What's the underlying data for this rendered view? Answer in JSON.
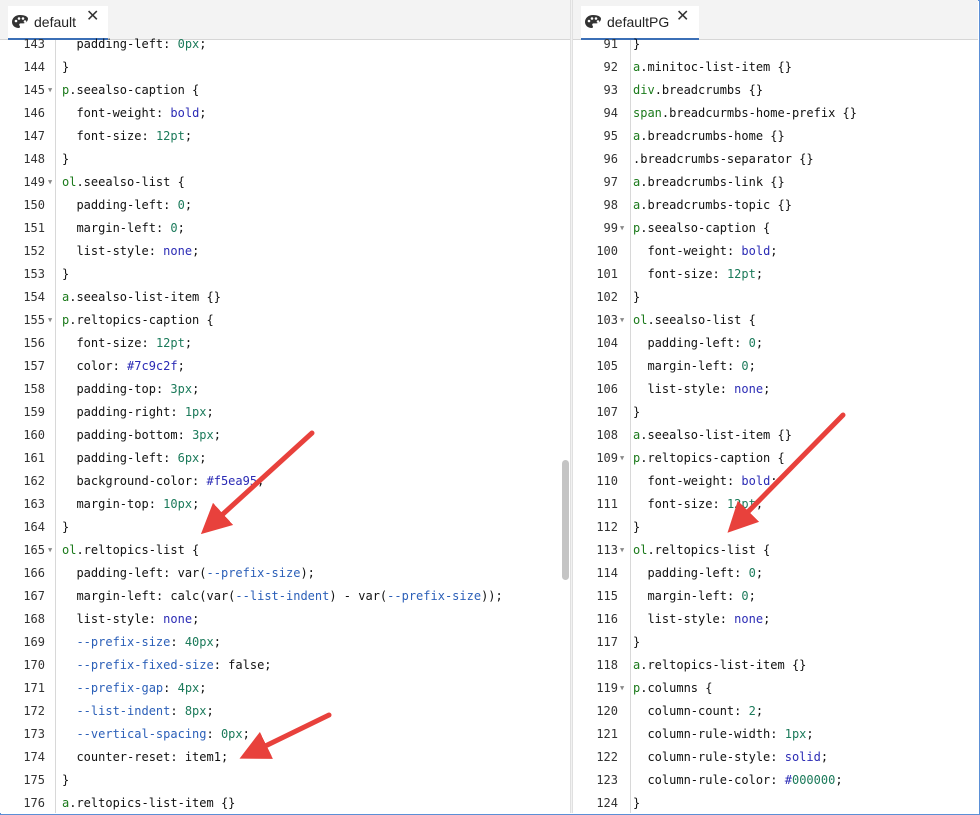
{
  "left_tab": {
    "label": "default",
    "close": "✕"
  },
  "right_tab": {
    "label": "defaultPG",
    "close": "✕"
  },
  "left_code": [
    {
      "n": "143",
      "t": "  padding-left: 0px;"
    },
    {
      "n": "144",
      "t": "}"
    },
    {
      "n": "145",
      "t": "p.seealso-caption {",
      "fold": true
    },
    {
      "n": "146",
      "t": "  font-weight: bold;"
    },
    {
      "n": "147",
      "t": "  font-size: 12pt;"
    },
    {
      "n": "148",
      "t": "}"
    },
    {
      "n": "149",
      "t": "ol.seealso-list {",
      "fold": true
    },
    {
      "n": "150",
      "t": "  padding-left: 0;"
    },
    {
      "n": "151",
      "t": "  margin-left: 0;"
    },
    {
      "n": "152",
      "t": "  list-style: none;"
    },
    {
      "n": "153",
      "t": "}"
    },
    {
      "n": "154",
      "t": "a.seealso-list-item {}"
    },
    {
      "n": "155",
      "t": "p.reltopics-caption {",
      "fold": true
    },
    {
      "n": "156",
      "t": "  font-size: 12pt;"
    },
    {
      "n": "157",
      "t": "  color: #7c9c2f;"
    },
    {
      "n": "158",
      "t": "  padding-top: 3px;"
    },
    {
      "n": "159",
      "t": "  padding-right: 1px;"
    },
    {
      "n": "160",
      "t": "  padding-bottom: 3px;"
    },
    {
      "n": "161",
      "t": "  padding-left: 6px;"
    },
    {
      "n": "162",
      "t": "  background-color: #f5ea95;"
    },
    {
      "n": "163",
      "t": "  margin-top: 10px;"
    },
    {
      "n": "164",
      "t": "}"
    },
    {
      "n": "165",
      "t": "ol.reltopics-list {",
      "fold": true
    },
    {
      "n": "166",
      "t": "  padding-left: var(--prefix-size);"
    },
    {
      "n": "167",
      "t": "  margin-left: calc(var(--list-indent) - var(--prefix-size));"
    },
    {
      "n": "168",
      "t": "  list-style: none;"
    },
    {
      "n": "169",
      "t": "  --prefix-size: 40px;"
    },
    {
      "n": "170",
      "t": "  --prefix-fixed-size: false;"
    },
    {
      "n": "171",
      "t": "  --prefix-gap: 4px;"
    },
    {
      "n": "172",
      "t": "  --list-indent: 8px;"
    },
    {
      "n": "173",
      "t": "  --vertical-spacing: 0px;"
    },
    {
      "n": "174",
      "t": "  counter-reset: item1;"
    },
    {
      "n": "175",
      "t": "}"
    },
    {
      "n": "176",
      "t": "a.reltopics-list-item {}"
    }
  ],
  "right_code": [
    {
      "n": "91",
      "t": "}"
    },
    {
      "n": "92",
      "t": "a.minitoc-list-item {}"
    },
    {
      "n": "93",
      "t": "div.breadcrumbs {}"
    },
    {
      "n": "94",
      "t": "span.breadcurmbs-home-prefix {}"
    },
    {
      "n": "95",
      "t": "a.breadcrumbs-home {}"
    },
    {
      "n": "96",
      "t": ".breadcrumbs-separator {}"
    },
    {
      "n": "97",
      "t": "a.breadcrumbs-link {}"
    },
    {
      "n": "98",
      "t": "a.breadcrumbs-topic {}"
    },
    {
      "n": "99",
      "t": "p.seealso-caption {",
      "fold": true
    },
    {
      "n": "100",
      "t": "  font-weight: bold;"
    },
    {
      "n": "101",
      "t": "  font-size: 12pt;"
    },
    {
      "n": "102",
      "t": "}"
    },
    {
      "n": "103",
      "t": "ol.seealso-list {",
      "fold": true
    },
    {
      "n": "104",
      "t": "  padding-left: 0;"
    },
    {
      "n": "105",
      "t": "  margin-left: 0;"
    },
    {
      "n": "106",
      "t": "  list-style: none;"
    },
    {
      "n": "107",
      "t": "}"
    },
    {
      "n": "108",
      "t": "a.seealso-list-item {}"
    },
    {
      "n": "109",
      "t": "p.reltopics-caption {",
      "fold": true
    },
    {
      "n": "110",
      "t": "  font-weight: bold;"
    },
    {
      "n": "111",
      "t": "  font-size: 12pt;"
    },
    {
      "n": "112",
      "t": "}"
    },
    {
      "n": "113",
      "t": "ol.reltopics-list {",
      "fold": true
    },
    {
      "n": "114",
      "t": "  padding-left: 0;"
    },
    {
      "n": "115",
      "t": "  margin-left: 0;"
    },
    {
      "n": "116",
      "t": "  list-style: none;"
    },
    {
      "n": "117",
      "t": "}"
    },
    {
      "n": "118",
      "t": "a.reltopics-list-item {}"
    },
    {
      "n": "119",
      "t": "p.columns {",
      "fold": true
    },
    {
      "n": "120",
      "t": "  column-count: 2;"
    },
    {
      "n": "121",
      "t": "  column-rule-width: 1px;"
    },
    {
      "n": "122",
      "t": "  column-rule-style: solid;"
    },
    {
      "n": "123",
      "t": "  column-rule-color: #000000;"
    },
    {
      "n": "124",
      "t": "}"
    }
  ],
  "colors": {
    "arrow": "#e8413c",
    "tab_underline": "#3b6fb6"
  }
}
